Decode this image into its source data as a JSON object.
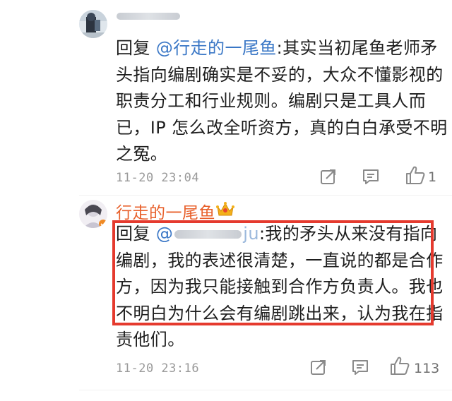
{
  "replies": [
    {
      "username": "",
      "reply_prefix": "回复 ",
      "mention": "@行走的一尾鱼",
      "reply_text": ":其实当初尾鱼老师矛头指向编剧确实是不妥的，大众不懂影视的职责分工和行业规则。编剧只是工具人而已，IP 怎么改全听资方，真的白白承受不明之冤。",
      "timestamp": "11-20 23:04",
      "like_count": "1"
    },
    {
      "username": "行走的一尾鱼",
      "reply_prefix": "回复 ",
      "mention": "@",
      "mention_tail": "ju",
      "reply_text": ":我的矛头从来没有指向编剧，我的表述很清楚，一直说的都是合作方，因为我只能接触到合作方负责人。我也不明白为什么会有编剧跳出来，认为我在指责他们。",
      "timestamp": "11-20 23:16",
      "like_count": "113"
    }
  ],
  "icons": {
    "share": "share-icon",
    "comment": "comment-icon",
    "like": "thumbs-up-icon",
    "badge": "crown-badge-icon"
  },
  "colors": {
    "username": "#e8612c",
    "mention": "#3a77c6",
    "highlight_border": "#e53a2e",
    "meta_text": "#9a9a9a"
  }
}
